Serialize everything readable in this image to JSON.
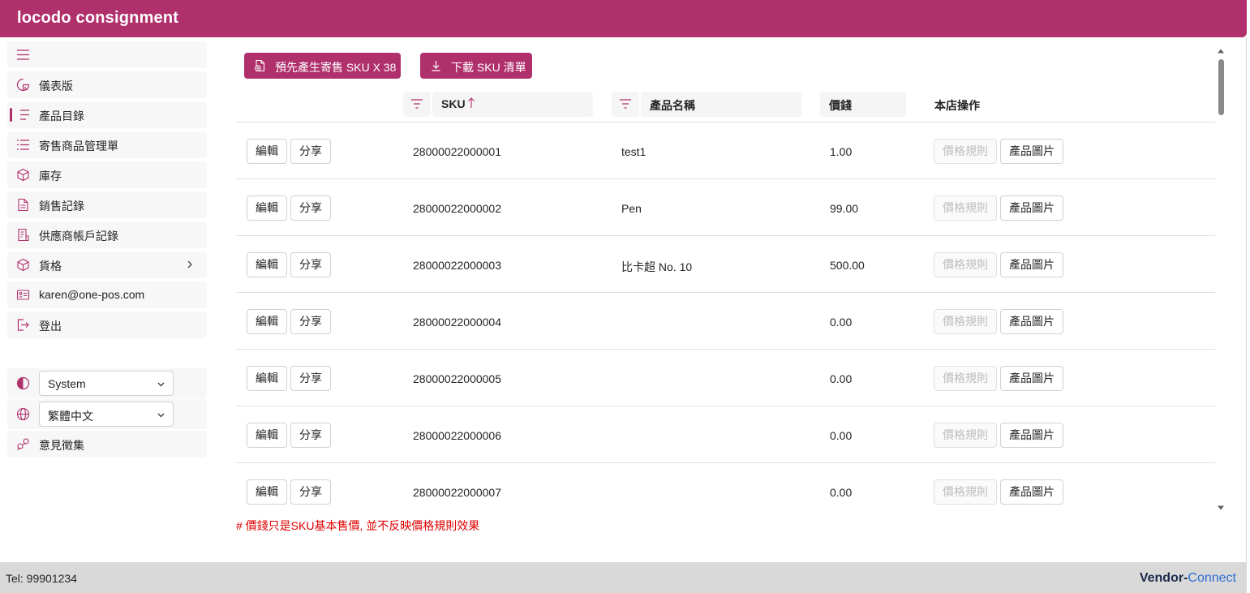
{
  "app": {
    "title": "locodo consignment"
  },
  "sidebar": {
    "items": [
      {
        "key": "menu",
        "label": "",
        "icon": "hamburger-icon"
      },
      {
        "key": "dashboard",
        "label": "儀表版",
        "icon": "gauge-icon"
      },
      {
        "key": "catalog",
        "label": "產品目錄",
        "icon": "list-icon",
        "active": true
      },
      {
        "key": "consignment",
        "label": "寄售商品管理單",
        "icon": "task-list-icon"
      },
      {
        "key": "inventory",
        "label": "庫存",
        "icon": "box-icon"
      },
      {
        "key": "sales",
        "label": "銷售記錄",
        "icon": "document-icon"
      },
      {
        "key": "vendor",
        "label": "供應商帳戶記錄",
        "icon": "receipt-icon"
      },
      {
        "key": "pricing",
        "label": "貨格",
        "icon": "box-icon",
        "has_children": true
      },
      {
        "key": "account",
        "label": "karen@one-pos.com",
        "icon": "id-card-icon"
      },
      {
        "key": "logout",
        "label": "登出",
        "icon": "sign-out-icon"
      }
    ],
    "theme": {
      "icon": "contrast-icon",
      "value": "System"
    },
    "language": {
      "icon": "globe-icon",
      "value": "繁體中文"
    },
    "feedback": {
      "icon": "feedback-icon",
      "label": "意見徵集"
    }
  },
  "actions": {
    "pregenerate_label": "預先產生寄售 SKU X 38",
    "download_label": "下載 SKU 清單"
  },
  "table": {
    "columns": {
      "sku": "SKU",
      "name": "產品名稱",
      "price": "價錢",
      "ops": "本店操作"
    },
    "row_buttons": {
      "edit": "編輯",
      "share": "分享",
      "price_rule": "價格規則",
      "images": "產品圖片"
    },
    "rows": [
      {
        "sku": "28000022000001",
        "name": "test1",
        "price": "1.00"
      },
      {
        "sku": "28000022000002",
        "name": "Pen",
        "price": "99.00"
      },
      {
        "sku": "28000022000003",
        "name": "比卡超 No. 10",
        "price": "500.00"
      },
      {
        "sku": "28000022000004",
        "name": "",
        "price": "0.00"
      },
      {
        "sku": "28000022000005",
        "name": "",
        "price": "0.00"
      },
      {
        "sku": "28000022000006",
        "name": "",
        "price": "0.00"
      },
      {
        "sku": "28000022000007",
        "name": "",
        "price": "0.00"
      }
    ],
    "note": "# 價錢只是SKU基本售價, 並不反映價格規則效果"
  },
  "footer": {
    "tel": "Tel: 99901234",
    "brand_part1": "Vendor-",
    "brand_part2": "Connect"
  },
  "colors": {
    "accent": "#b0306c",
    "note": "#e00000",
    "footer_bg": "#d9d9d9"
  }
}
